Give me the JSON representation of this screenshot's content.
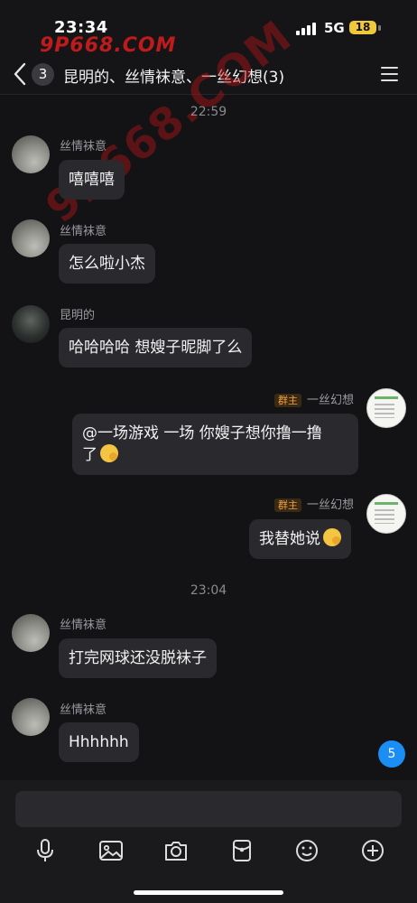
{
  "status_bar": {
    "time": "23:34",
    "network": "5G",
    "battery": "18"
  },
  "watermarks": {
    "top": "9P668.COM",
    "diagonal": "9P668.COM"
  },
  "header": {
    "unread_count": "3",
    "title": "昆明的、丝情袜意、一丝幻想(3)"
  },
  "timestamps": [
    "22:59",
    "23:04"
  ],
  "messages": [
    {
      "sender": "丝情袜意",
      "text": "嘻嘻嘻"
    },
    {
      "sender": "丝情袜意",
      "text": "怎么啦小杰"
    },
    {
      "sender": "昆明的",
      "text": "哈哈哈哈 想嫂子昵脚了么"
    },
    {
      "sender": "一丝幻想",
      "role": "群主",
      "text_line1": "@一场游戏 一场 你嫂子想你撸一撸",
      "text_line2": "了"
    },
    {
      "sender": "一丝幻想",
      "role": "群主",
      "text": "我替她说"
    },
    {
      "sender": "丝情袜意",
      "text": "打完网球还没脱袜子"
    },
    {
      "sender": "丝情袜意",
      "text": "Hhhhhh"
    }
  ],
  "new_messages_badge": "5",
  "composer": {
    "input_value": "",
    "tools": [
      "microphone-icon",
      "image-icon",
      "camera-icon",
      "red-packet-icon",
      "emoji-icon",
      "plus-icon"
    ]
  },
  "colors": {
    "background": "#131316",
    "bubble": "#2a2a2e",
    "accent": "#1a8ef2",
    "owner_badge": "#f0a040"
  }
}
